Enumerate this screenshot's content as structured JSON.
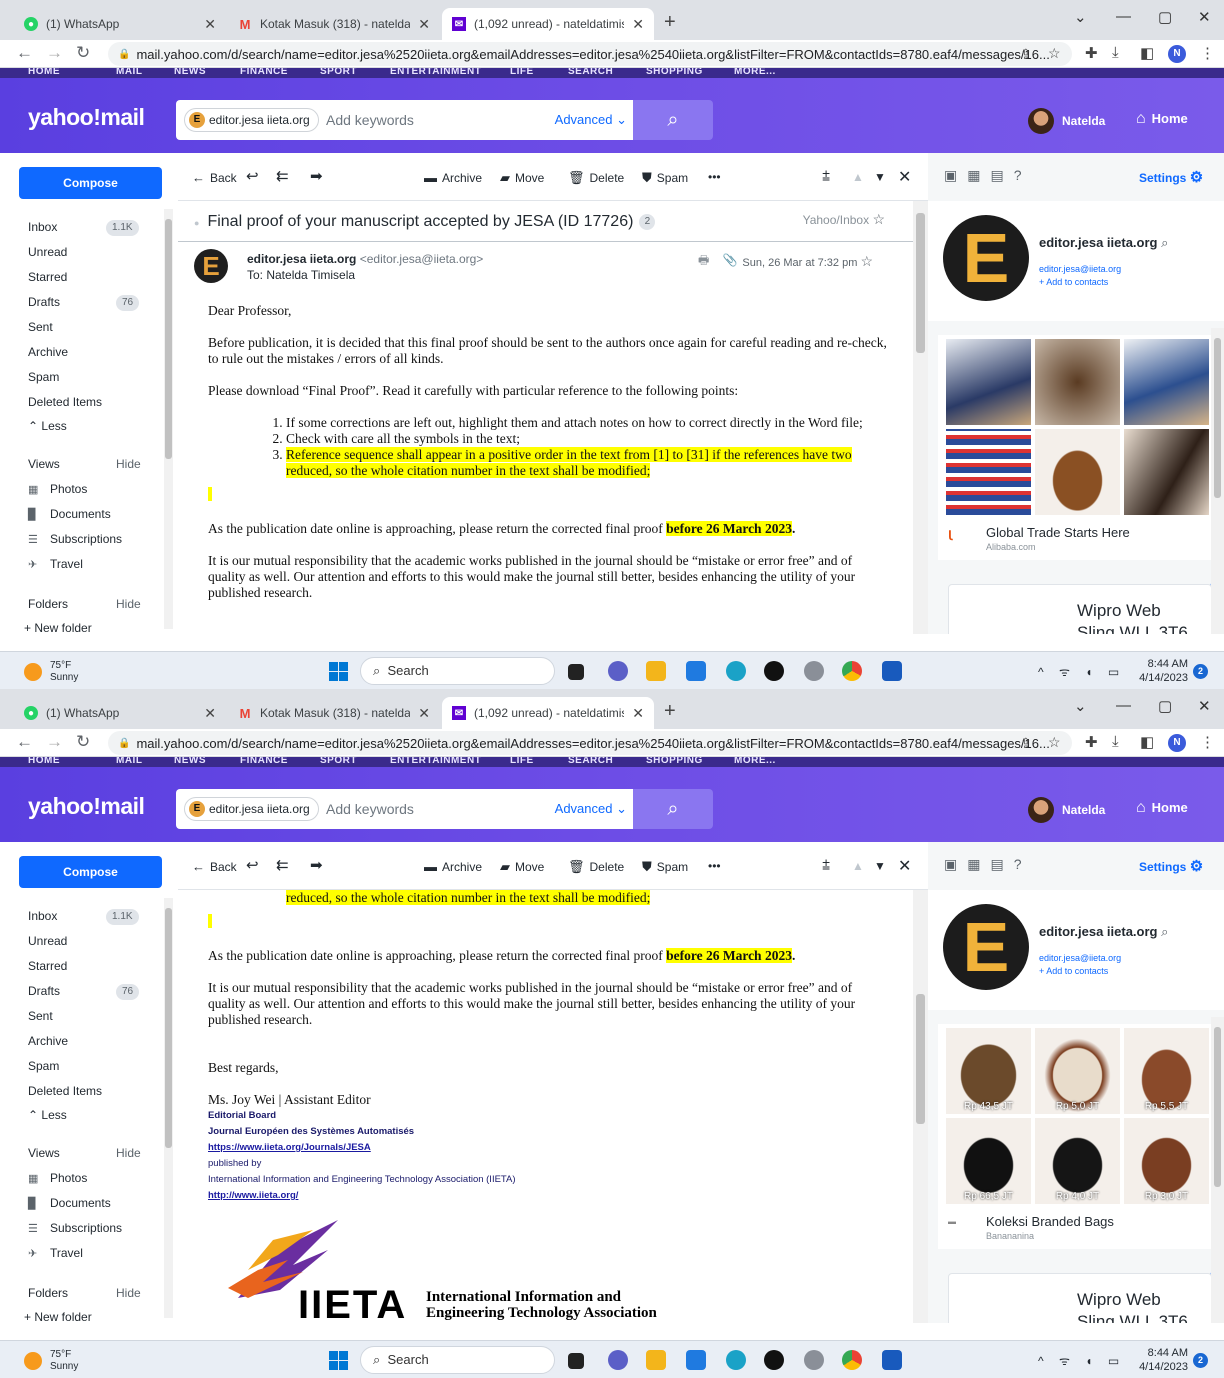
{
  "browser": {
    "tabs": [
      {
        "title": "(1) WhatsApp",
        "color": "#25d366"
      },
      {
        "title": "Kotak Masuk (318) - nateldatimis",
        "color": "#ea4335"
      },
      {
        "title": "(1,092 unread) - nateldatimisela@",
        "color": "#6001d2"
      }
    ],
    "url": "mail.yahoo.com/d/search/name=editor.jesa%2520iieta.org&emailAddresses=editor.jesa%2540iieta.org&listFilter=FROM&contactIds=8780.eaf4/messages/16...",
    "profile_initial": "N"
  },
  "yahoo": {
    "top_strip": [
      "HOME",
      "MAIL",
      "NEWS",
      "FINANCE",
      "SPORT",
      "ENTERTAINMENT",
      "LIFE",
      "SEARCH",
      "SHOPPING",
      "MORE..."
    ],
    "logo": "yahoo!mail",
    "search_chip": "editor.jesa iieta.org",
    "search_placeholder": "Add keywords",
    "advanced": "Advanced",
    "user_name": "Natelda",
    "home": "Home"
  },
  "sidebar": {
    "compose": "Compose",
    "items": [
      {
        "label": "Inbox",
        "badge": "1.1K"
      },
      {
        "label": "Unread"
      },
      {
        "label": "Starred"
      },
      {
        "label": "Drafts",
        "badge": "76"
      },
      {
        "label": "Sent"
      },
      {
        "label": "Archive"
      },
      {
        "label": "Spam"
      },
      {
        "label": "Deleted Items"
      },
      {
        "label": "Less"
      }
    ],
    "views": "Views",
    "hide": "Hide",
    "view_items": [
      "Photos",
      "Documents",
      "Subscriptions",
      "Travel"
    ],
    "folders": "Folders",
    "new_folder": "+ New folder"
  },
  "toolbar": {
    "back": "Back",
    "archive": "Archive",
    "move": "Move",
    "delete": "Delete",
    "spam": "Spam",
    "more": "•••"
  },
  "message": {
    "subject": "Final proof of your manuscript accepted by JESA (ID 17726)",
    "count": "2",
    "folder": "Yahoo/Inbox",
    "sender_name": "editor.jesa iieta.org",
    "sender_email": "<editor.jesa@iieta.org>",
    "to": "To: Natelda Timisela",
    "date": "Sun, 26 Mar at 7:32 pm",
    "greeting": "Dear Professor,",
    "para1": "Before publication, it is decided that this final proof should be sent to the authors once again for careful reading and re-check, to rule out the mistakes / errors of all kinds.",
    "para2": "Please download “Final Proof”. Read it carefully with particular reference to the following points:",
    "points": [
      "If some corrections are left out, highlight them and attach notes on how to correct directly in the Word file;",
      "Check with care all the symbols in the text;",
      "Reference sequence shall appear in a positive order in the text from [1] to [31] if the references have two reduced, so the whole citation number in the text shall be modified;"
    ],
    "para3": "As the publication date online is approaching, please return the corrected final proof",
    "deadline": "before 26 March 2023",
    "para4": "It is our mutual responsibility that the academic works published in the journal should be “mistake or error free” and of quality as well. Our attention and efforts to this would make the journal still better, besides enhancing the utility of your published research.",
    "regards": "Best regards,",
    "sig_name": "Ms. Joy Wei | Assistant Editor",
    "sig_board": "Editorial Board",
    "sig_journal": "Journal Européen des Systèmes Automatisés",
    "sig_link1": "https://www.iieta.org/Journals/JESA",
    "sig_pub": "published by",
    "sig_assoc": "International Information and Engineering Technology Association (IIETA)",
    "sig_link2": "http://www.iieta.org/",
    "logo_text": "IIETA",
    "logo_line1": "International Information and",
    "logo_line2": "Engineering Technology Association"
  },
  "right": {
    "settings": "Settings",
    "contact_name": "editor.jesa iieta.org",
    "contact_email": "editor.jesa@iieta.org",
    "add_contact": "+ Add to contacts",
    "ad1_title": "Global Trade Starts Here",
    "ad1_src": "Alibaba.com",
    "ad2_title": "Koleksi Branded Bags",
    "ad2_src": "Banananina",
    "ad2_prices": [
      "Rp 43,5 JT",
      "Rp 5,0 JT",
      "Rp 5,5 JT",
      "Rp 66,5 JT",
      "Rp 4,0 JT",
      "Rp 3,0 JT"
    ],
    "wipro_1": "Wipro Web",
    "wipro_2": "Sling WLL 3T6"
  },
  "taskbar": {
    "temp": "75°F",
    "cond": "Sunny",
    "search": "Search",
    "time": "8:44 AM",
    "date": "4/14/2023",
    "notif": "2"
  }
}
